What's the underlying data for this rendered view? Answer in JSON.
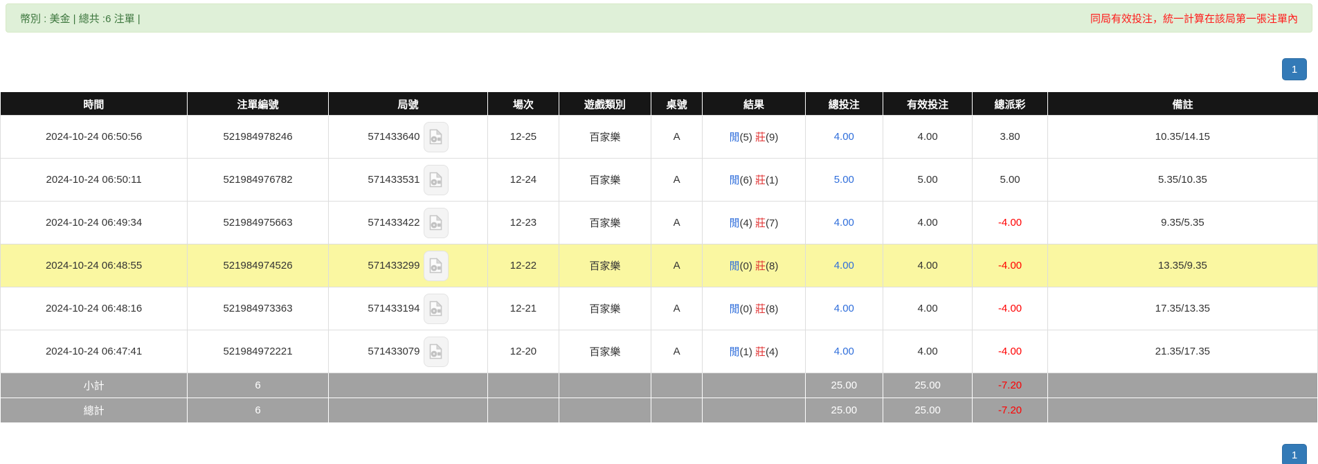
{
  "alert": {
    "left_text": "幣別 : 美金 | 總共 :6 注單 |",
    "right_text": "同局有效投注，統一計算在該局第一張注單內"
  },
  "pagination": {
    "page_label": "1"
  },
  "icons": {
    "round_video": "film-file-icon"
  },
  "colors": {
    "alert_bg": "#dff0d8",
    "alert_text": "#3c763d",
    "notice_red": "#ff1a1a",
    "header_bg": "#161616",
    "highlight_row": "#faf7a1",
    "summary_bg": "#a2a2a2",
    "link_blue": "#2f6edb",
    "player_blue": "#2f6edb",
    "banker_red": "#e03131",
    "negative_red": "#ff0000",
    "pagination_bg": "#337ab7"
  },
  "table": {
    "headers": {
      "time": "時間",
      "bet_id": "注單編號",
      "round_id": "局號",
      "session": "場次",
      "game": "遊戲類別",
      "table_no": "桌號",
      "result": "結果",
      "total_bet": "總投注",
      "valid_bet": "有效投注",
      "payout": "總派彩",
      "remark": "備註"
    },
    "rows": [
      {
        "time": "2024-10-24 06:50:56",
        "bet_id": "521984978246",
        "round_id": "571433640",
        "session": "12-25",
        "game": "百家樂",
        "table_no": "A",
        "player": "閒",
        "player_n": "(5)",
        "banker": "莊",
        "banker_n": "(9)",
        "total_bet": "4.00",
        "valid_bet": "4.00",
        "payout": "3.80",
        "remark": "10.35/14.15"
      },
      {
        "time": "2024-10-24 06:50:11",
        "bet_id": "521984976782",
        "round_id": "571433531",
        "session": "12-24",
        "game": "百家樂",
        "table_no": "A",
        "player": "閒",
        "player_n": "(6)",
        "banker": "莊",
        "banker_n": "(1)",
        "total_bet": "5.00",
        "valid_bet": "5.00",
        "payout": "5.00",
        "remark": "5.35/10.35"
      },
      {
        "time": "2024-10-24 06:49:34",
        "bet_id": "521984975663",
        "round_id": "571433422",
        "session": "12-23",
        "game": "百家樂",
        "table_no": "A",
        "player": "閒",
        "player_n": "(4)",
        "banker": "莊",
        "banker_n": "(7)",
        "total_bet": "4.00",
        "valid_bet": "4.00",
        "payout": "-4.00",
        "remark": "9.35/5.35"
      },
      {
        "time": "2024-10-24 06:48:55",
        "bet_id": "521984974526",
        "round_id": "571433299",
        "session": "12-22",
        "game": "百家樂",
        "table_no": "A",
        "player": "閒",
        "player_n": "(0)",
        "banker": "莊",
        "banker_n": "(8)",
        "total_bet": "4.00",
        "valid_bet": "4.00",
        "payout": "-4.00",
        "remark": "13.35/9.35"
      },
      {
        "time": "2024-10-24 06:48:16",
        "bet_id": "521984973363",
        "round_id": "571433194",
        "session": "12-21",
        "game": "百家樂",
        "table_no": "A",
        "player": "閒",
        "player_n": "(0)",
        "banker": "莊",
        "banker_n": "(8)",
        "total_bet": "4.00",
        "valid_bet": "4.00",
        "payout": "-4.00",
        "remark": "17.35/13.35"
      },
      {
        "time": "2024-10-24 06:47:41",
        "bet_id": "521984972221",
        "round_id": "571433079",
        "session": "12-20",
        "game": "百家樂",
        "table_no": "A",
        "player": "閒",
        "player_n": "(1)",
        "banker": "莊",
        "banker_n": "(4)",
        "total_bet": "4.00",
        "valid_bet": "4.00",
        "payout": "-4.00",
        "remark": "21.35/17.35"
      }
    ],
    "subtotal": {
      "label": "小計",
      "count": "6",
      "total_bet": "25.00",
      "valid_bet": "25.00",
      "payout": "-7.20"
    },
    "total": {
      "label": "總計",
      "count": "6",
      "total_bet": "25.00",
      "valid_bet": "25.00",
      "payout": "-7.20"
    }
  }
}
